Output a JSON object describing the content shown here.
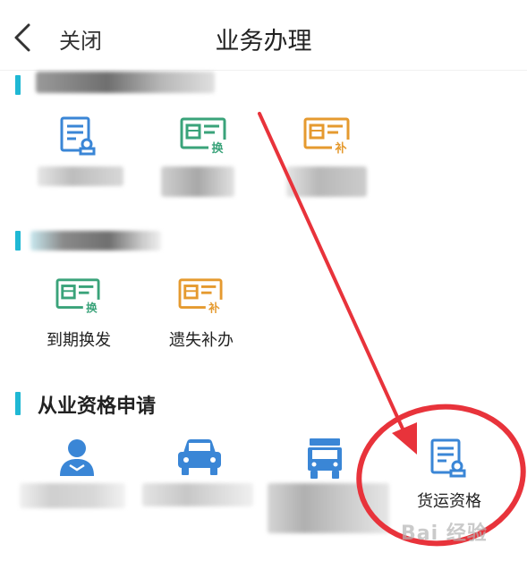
{
  "header": {
    "back_icon": "chevron-left-icon",
    "close_label": "关闭",
    "title": "业务办理"
  },
  "section_renewal": {
    "items": [
      {
        "label": "到期换发",
        "icon": "card-renew-icon"
      },
      {
        "label": "遗失补办",
        "icon": "card-reissue-icon"
      }
    ]
  },
  "section_qualification": {
    "title": "从业资格申请",
    "items": [
      {
        "label": "货运资格",
        "icon": "freight-certificate-icon"
      }
    ]
  },
  "annotation": {
    "arrow_color": "#e8333b",
    "circle_color": "#e8333b"
  },
  "watermark": {
    "text": "Bai 经验"
  },
  "colors": {
    "accent": "#1fb8d4",
    "icon_blue": "#3a86d6",
    "icon_green": "#3aa37a",
    "icon_orange": "#e59a2f"
  }
}
